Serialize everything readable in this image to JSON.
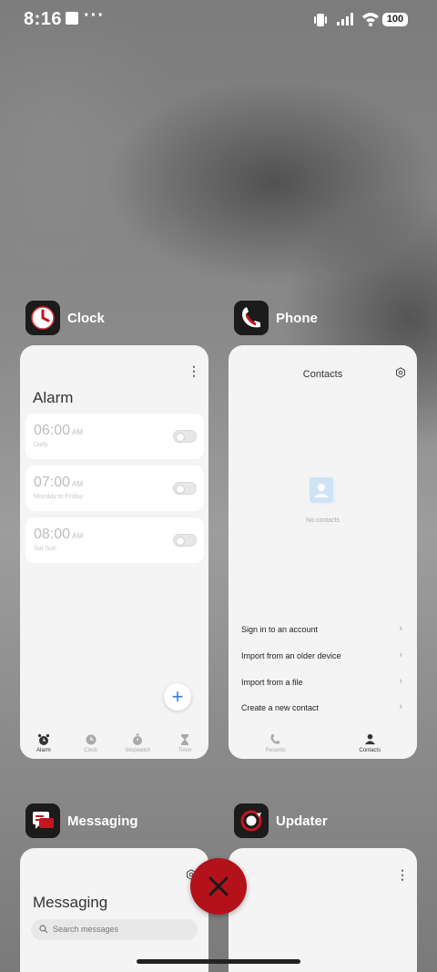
{
  "status_bar": {
    "time": "8:16",
    "overflow": "···",
    "battery": "100"
  },
  "clock": {
    "app_name": "Clock",
    "title": "Alarm",
    "alarms": [
      {
        "time": "06:00",
        "ampm": "AM",
        "repeat": "Daily",
        "enabled": false
      },
      {
        "time": "07:00",
        "ampm": "AM",
        "repeat": "Monday to Friday",
        "enabled": false
      },
      {
        "time": "08:00",
        "ampm": "AM",
        "repeat": "Sat Sun",
        "enabled": false
      }
    ],
    "tabs": [
      {
        "label": "Alarm",
        "icon": "alarm-icon",
        "active": true
      },
      {
        "label": "Clock",
        "icon": "clock-icon",
        "active": false
      },
      {
        "label": "Stopwatch",
        "icon": "stopwatch-icon",
        "active": false
      },
      {
        "label": "Timer",
        "icon": "timer-icon",
        "active": false
      }
    ]
  },
  "phone": {
    "app_name": "Phone",
    "title": "Contacts",
    "empty_text": "No contacts",
    "options": [
      "Sign in to an account",
      "Import from an older device",
      "Import from a file",
      "Create a new contact"
    ],
    "tabs": [
      {
        "label": "Recents",
        "icon": "phone-icon",
        "active": false
      },
      {
        "label": "Contacts",
        "icon": "person-icon",
        "active": true
      }
    ]
  },
  "messaging": {
    "app_name": "Messaging",
    "title": "Messaging",
    "search_placeholder": "Search messages"
  },
  "updater": {
    "app_name": "Updater"
  },
  "colors": {
    "accent_red": "#b3121a",
    "fab_blue": "#2b7de9"
  }
}
